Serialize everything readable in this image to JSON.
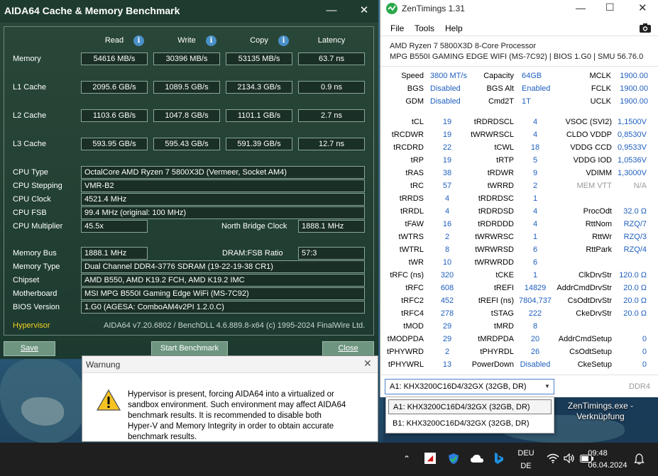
{
  "aida": {
    "title": "AIDA64 Cache & Memory Benchmark",
    "col_read": "Read",
    "col_write": "Write",
    "col_copy": "Copy",
    "col_latency": "Latency",
    "info_glyph": "i",
    "rows": [
      {
        "label": "Memory",
        "read": "54616 MB/s",
        "write": "30396 MB/s",
        "copy": "53135 MB/s",
        "latency": "63.7 ns"
      },
      {
        "label": "L1 Cache",
        "read": "2095.6 GB/s",
        "write": "1089.5 GB/s",
        "copy": "2134.3 GB/s",
        "latency": "0.9 ns"
      },
      {
        "label": "L2 Cache",
        "read": "1103.6 GB/s",
        "write": "1047.8 GB/s",
        "copy": "1101.1 GB/s",
        "latency": "2.7 ns"
      },
      {
        "label": "L3 Cache",
        "read": "593.95 GB/s",
        "write": "595.43 GB/s",
        "copy": "591.39 GB/s",
        "latency": "12.7 ns"
      }
    ],
    "cpu_type_label": "CPU Type",
    "cpu_type": "OctalCore AMD Ryzen 7 5800X3D  (Vermeer, Socket AM4)",
    "cpu_stepping_label": "CPU Stepping",
    "cpu_stepping": "VMR-B2",
    "cpu_clock_label": "CPU Clock",
    "cpu_clock": "4521.4 MHz",
    "cpu_fsb_label": "CPU FSB",
    "cpu_fsb": "99.4 MHz  (original: 100 MHz)",
    "cpu_mult_label": "CPU Multiplier",
    "cpu_mult": "45.5x",
    "nb_clock_label": "North Bridge Clock",
    "nb_clock": "1888.1 MHz",
    "mem_bus_label": "Memory Bus",
    "mem_bus": "1888.1 MHz",
    "dram_ratio_label": "DRAM:FSB Ratio",
    "dram_ratio": "57:3",
    "mem_type_label": "Memory Type",
    "mem_type": "Dual Channel DDR4-3776 SDRAM  (19-22-19-38 CR1)",
    "chipset_label": "Chipset",
    "chipset": "AMD B550, AMD K19.2 FCH, AMD K19.2 IMC",
    "mobo_label": "Motherboard",
    "mobo": "MSI MPG B550I Gaming Edge WiFi (MS-7C92)",
    "bios_label": "BIOS Version",
    "bios": "1.G0  (AGESA: ComboAM4v2PI 1.2.0.C)",
    "hypervisor": "Hypervisor",
    "version": "AIDA64 v7.20.6802 / BenchDLL 4.6.889.8-x64  (c) 1995-2024 FinalWire Ltd.",
    "save": "Save",
    "start": "Start Benchmark",
    "close": "Close"
  },
  "warning": {
    "title": "Warnung",
    "lines": [
      "Hypervisor is present, forcing AIDA64 into a virtualized or",
      "sandbox environment.  Such environment may affect AIDA64",
      "benchmark results.  It is recommended to disable both",
      "Hyper-V and Memory Integrity in order to obtain accurate",
      "benchmark results."
    ]
  },
  "zen": {
    "title": "ZenTimings 1.31",
    "menu": [
      "File",
      "Tools",
      "Help"
    ],
    "cpu": "AMD Ryzen 7 5800X3D 8-Core Processor",
    "board": "MPG B550I GAMING EDGE WIFI (MS-7C92) | BIOS 1.G0 | SMU 56.76.0",
    "top_rows": [
      [
        "Speed",
        "3800 MT/s",
        "Capacity",
        "64GB",
        "MCLK",
        "1900.00"
      ],
      [
        "BGS",
        "Disabled",
        "BGS Alt",
        "Enabled",
        "FCLK",
        "1900.00"
      ],
      [
        "GDM",
        "Disabled",
        "Cmd2T",
        "1T",
        "UCLK",
        "1900.00"
      ]
    ],
    "rows": [
      [
        "tCL",
        "19",
        "tRDRDSCL",
        "4",
        "VSOC (SVI2)",
        "1,1500V"
      ],
      [
        "tRCDWR",
        "19",
        "tWRWRSCL",
        "4",
        "CLDO VDDP",
        "0,8530V"
      ],
      [
        "tRCDRD",
        "22",
        "tCWL",
        "18",
        "VDDG CCD",
        "0,9533V"
      ],
      [
        "tRP",
        "19",
        "tRTP",
        "5",
        "VDDG IOD",
        "1,0536V"
      ],
      [
        "tRAS",
        "38",
        "tRDWR",
        "9",
        "VDIMM",
        "1,3000V"
      ],
      [
        "tRC",
        "57",
        "tWRRD",
        "2",
        "MEM VTT",
        "N/A"
      ],
      [
        "tRRDS",
        "4",
        "tRDRDSC",
        "1",
        "",
        ""
      ],
      [
        "tRRDL",
        "4",
        "tRDRDSD",
        "4",
        "ProcOdt",
        "32.0 Ω"
      ],
      [
        "tFAW",
        "16",
        "tRDRDDD",
        "4",
        "RttNom",
        "RZQ/7"
      ],
      [
        "tWTRS",
        "2",
        "tWRWRSC",
        "1",
        "RttWr",
        "RZQ/3"
      ],
      [
        "tWTRL",
        "8",
        "tWRWRSD",
        "6",
        "RttPark",
        "RZQ/4"
      ],
      [
        "tWR",
        "10",
        "tWRWRDD",
        "6",
        "",
        ""
      ],
      [
        "tRFC (ns)",
        "320",
        "tCKE",
        "1",
        "ClkDrvStr",
        "120.0 Ω"
      ],
      [
        "tRFC",
        "608",
        "tREFI",
        "14829",
        "AddrCmdDrvStr",
        "20.0 Ω"
      ],
      [
        "tRFC2",
        "452",
        "tREFI (ns)",
        "7804,737",
        "CsOdtDrvStr",
        "20.0 Ω"
      ],
      [
        "tRFC4",
        "278",
        "tSTAG",
        "222",
        "CkeDrvStr",
        "20.0 Ω"
      ],
      [
        "tMOD",
        "29",
        "tMRD",
        "8",
        "",
        ""
      ],
      [
        "tMODPDA",
        "29",
        "tMRDPDA",
        "20",
        "AddrCmdSetup",
        "0"
      ],
      [
        "tPHYWRD",
        "2",
        "tPHYRDL",
        "26",
        "CsOdtSetup",
        "0"
      ],
      [
        "tPHYWRL",
        "13",
        "PowerDown",
        "Disabled",
        "CkeSetup",
        "0"
      ]
    ],
    "dimm_selected": "A1: KHX3200C16D4/32GX (32GB, DR)",
    "dimm_options": [
      "A1: KHX3200C16D4/32GX (32GB, DR)",
      "B1: KHX3200C16D4/32GX (32GB, DR)"
    ],
    "ddr": "DDR4",
    "status_color": "#2aa84a",
    "value_color": "#1f5fbf"
  },
  "desktop": {
    "shortcut": "ZenTimings.exe - Verknüpfung"
  },
  "taskbar": {
    "lang1": "DEU",
    "lang2": "DE",
    "time": "09:48",
    "date": "06.04.2024",
    "tray_icons": [
      "chevron-up-icon",
      "amd-icon",
      "defender-icon",
      "cloud-icon",
      "eye-icon",
      "bing-icon",
      "wifi-icon",
      "speaker-icon",
      "battery-icon",
      "bell-icon"
    ]
  }
}
